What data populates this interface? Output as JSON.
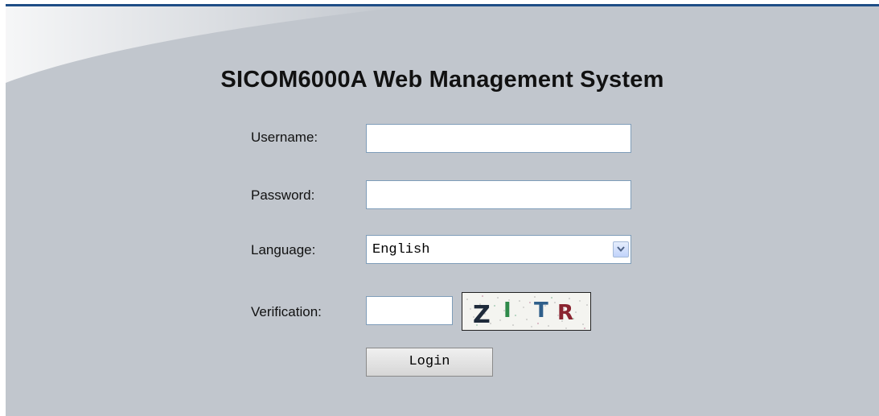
{
  "page": {
    "title": "SICOM6000A Web Management System"
  },
  "form": {
    "username_label": "Username:",
    "username_value": "",
    "password_label": "Password:",
    "password_value": "",
    "language_label": "Language:",
    "language_selected": "English",
    "verification_label": "Verification:",
    "verification_value": "",
    "captcha_text": "ZITR",
    "login_label": "Login"
  },
  "colors": {
    "background": "#c1c6cd",
    "top_border": "#1e4d86",
    "input_border": "#7f9db9"
  },
  "icons": {
    "dropdown": "chevron-down-icon"
  }
}
